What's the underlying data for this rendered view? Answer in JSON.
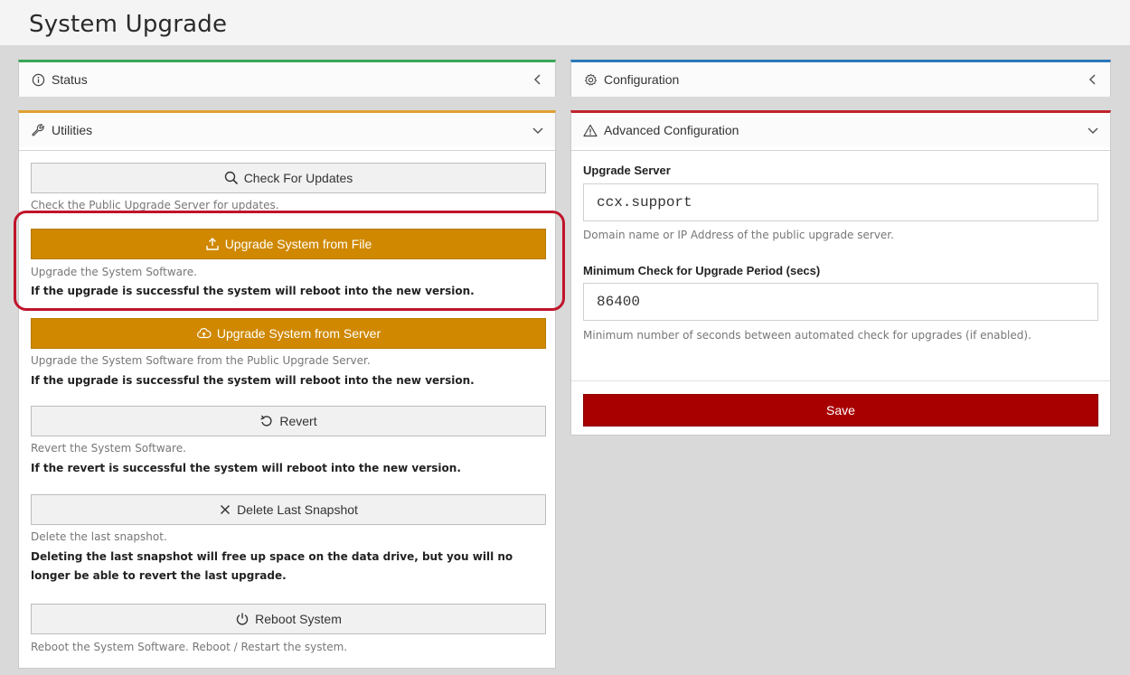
{
  "page": {
    "title": "System Upgrade"
  },
  "status_panel": {
    "title": "Status"
  },
  "configuration_panel": {
    "title": "Configuration"
  },
  "utilities_panel": {
    "title": "Utilities",
    "check_updates": {
      "label": "Check For Updates",
      "desc": "Check the Public Upgrade Server for updates."
    },
    "upgrade_file": {
      "label": "Upgrade System from File",
      "desc": "Upgrade the System Software.",
      "note": "If the upgrade is successful the system will reboot into the new version."
    },
    "upgrade_server": {
      "label": "Upgrade System from Server",
      "desc": "Upgrade the System Software from the Public Upgrade Server.",
      "note": "If the upgrade is successful the system will reboot into the new version."
    },
    "revert": {
      "label": "Revert",
      "desc": "Revert the System Software.",
      "note": "If the revert is successful the system will reboot into the new version."
    },
    "delete_snapshot": {
      "label": "Delete Last Snapshot",
      "desc": "Delete the last snapshot.",
      "note": "Deleting the last snapshot will free up space on the data drive, but you will no longer be able to revert the last upgrade."
    },
    "reboot": {
      "label": "Reboot System",
      "desc": "Reboot the System Software. Reboot / Restart the system."
    }
  },
  "advanced_panel": {
    "title": "Advanced Configuration",
    "upgrade_server": {
      "label": "Upgrade Server",
      "value": "ccx.support",
      "help": "Domain name or IP Address of the public upgrade server."
    },
    "min_check": {
      "label": "Minimum Check for Upgrade Period (secs)",
      "value": "86400",
      "help": "Minimum number of seconds between automated check for upgrades (if enabled)."
    },
    "save_label": "Save"
  },
  "colors": {
    "orange_button": "#cf8800",
    "save_button": "#a80000",
    "highlight": "#c0142b",
    "status_accent": "#3aa657",
    "config_accent": "#2b78b8",
    "utilities_accent": "#e0a130",
    "advanced_accent": "#c0242b"
  }
}
